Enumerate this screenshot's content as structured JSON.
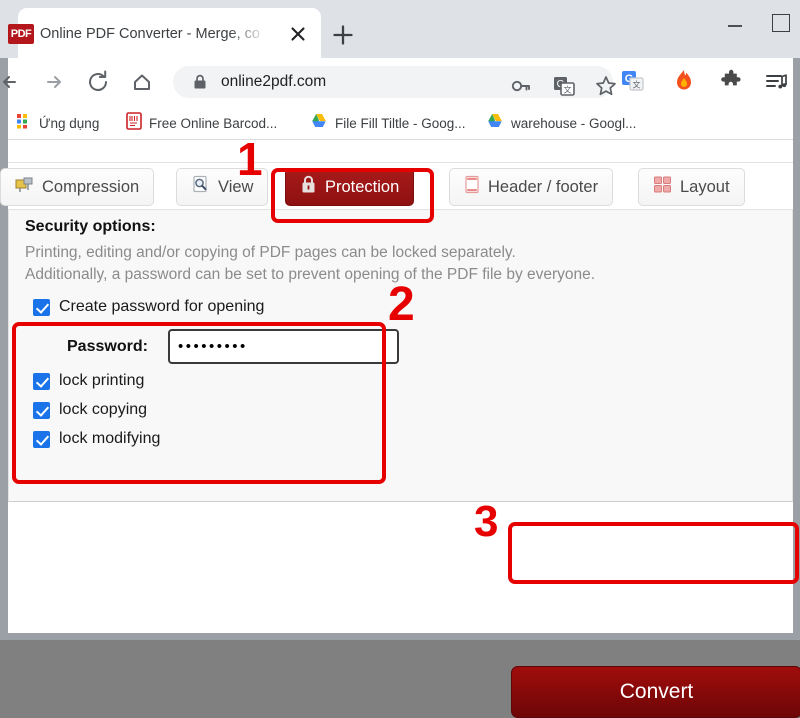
{
  "browser": {
    "tab": {
      "title": "Online PDF Converter - Merge, co",
      "favicon_text": "PDF",
      "close_icon": "close-icon"
    },
    "new_tab_label": "+",
    "window_controls": {
      "minimize": "minimize-icon",
      "maximize": "maximize-icon"
    },
    "nav": {
      "back": "back-arrow-icon",
      "forward": "forward-arrow-icon",
      "reload": "reload-icon",
      "home": "home-icon"
    },
    "omnibox": {
      "url": "online2pdf.com",
      "lock_icon": "lock-icon",
      "key_icon": "key-icon",
      "translate_icon": "translate-icon",
      "star_icon": "star-bookmark-icon"
    },
    "extensions": [
      {
        "name": "google-translate-extension-icon"
      },
      {
        "name": "flame-extension-icon"
      },
      {
        "name": "puzzle-extensions-icon"
      },
      {
        "name": "media-playlist-icon"
      }
    ],
    "bookmarks": [
      {
        "label": "Ứng dụng",
        "icon": "apps-grid-icon"
      },
      {
        "label": "Free Online Barcod...",
        "icon": "barcode-icon"
      },
      {
        "label": "File Fill Tiltle - Goog...",
        "icon": "google-drive-icon"
      },
      {
        "label": "warehouse - Googl...",
        "icon": "google-drive-icon"
      }
    ]
  },
  "page": {
    "option_tabs": [
      {
        "label": "Compression",
        "icon": "compression-icon",
        "active": false
      },
      {
        "label": "View",
        "icon": "view-magnifier-icon",
        "active": false
      },
      {
        "label": "Protection",
        "icon": "lock-icon",
        "active": true
      },
      {
        "label": "Header / footer",
        "icon": "header-footer-icon",
        "active": false
      },
      {
        "label": "Layout",
        "icon": "layout-grid-icon",
        "active": false
      }
    ],
    "security": {
      "title": "Security options:",
      "description_line1": "Printing, editing and/or copying of PDF pages can be locked separately.",
      "description_line2": "Additionally, a password can be set to prevent opening of the PDF file by everyone.",
      "options": [
        {
          "label": "Create password for opening",
          "checked": true
        },
        {
          "label": "lock printing",
          "checked": true
        },
        {
          "label": "lock copying",
          "checked": true
        },
        {
          "label": "lock modifying",
          "checked": true
        }
      ],
      "password_label": "Password:",
      "password_value": "•••••••••"
    },
    "convert_label": "Convert"
  },
  "annotations": {
    "step1": "1",
    "step2": "2",
    "step3": "3",
    "color": "#e60000"
  }
}
